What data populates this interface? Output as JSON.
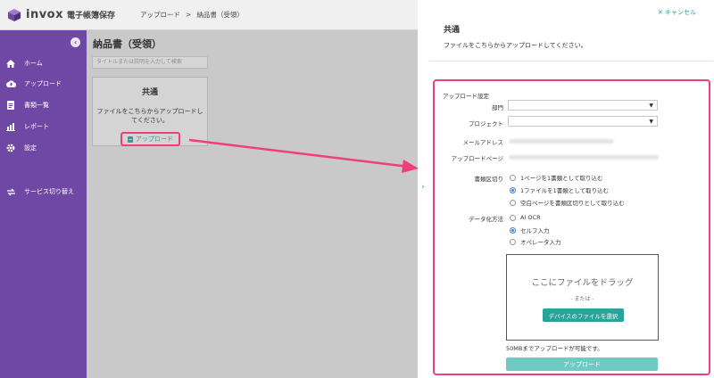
{
  "header": {
    "logo_text": "invox",
    "logo_sub": "電子帳簿保存",
    "breadcrumb": [
      "アップロード",
      "納品書（受領）"
    ],
    "breadcrumb_sep": ">"
  },
  "sidebar": {
    "collapse_icon": "chevron-left-icon",
    "items": [
      {
        "label": "ホーム",
        "icon": "home-icon"
      },
      {
        "label": "アップロード",
        "icon": "cloud-upload-icon"
      },
      {
        "label": "書類一覧",
        "icon": "document-icon"
      },
      {
        "label": "レポート",
        "icon": "chart-icon"
      },
      {
        "label": "設定",
        "icon": "gear-icon"
      },
      {
        "label": "サービス切り替え",
        "icon": "switch-icon"
      }
    ]
  },
  "main": {
    "title": "納品書（受領）",
    "search_placeholder": "タイトルまたは説明を入力して検索",
    "card": {
      "title": "共通",
      "description": "ファイルをこちらからアップロードしてください。",
      "upload_label": "アップロード"
    }
  },
  "panel": {
    "cancel_label": "キャンセル",
    "title": "共通",
    "description": "ファイルをこちらからアップロードしてください。",
    "section_label": "アップロード設定",
    "department_label": "部門",
    "department_value": "",
    "project_label": "プロジェクト",
    "project_value": "",
    "email_label": "メールアドレス",
    "upload_page_label": "アップロードページ",
    "split_label": "書類区切り",
    "split_options": [
      {
        "label": "1ページを1書類として取り込む",
        "selected": false
      },
      {
        "label": "1ファイルを1書類として取り込む",
        "selected": true
      },
      {
        "label": "空白ページを書類区切りとして取り込む",
        "selected": false
      }
    ],
    "method_label": "データ化方法",
    "method_options": [
      {
        "label": "AI OCR",
        "selected": false
      },
      {
        "label": "セルフ入力",
        "selected": true
      },
      {
        "label": "オペレータ入力",
        "selected": false
      }
    ],
    "dropzone_title": "ここにファイルをドラッグ",
    "dropzone_or": "- または -",
    "select_file_label": "デバイスのファイルを選択",
    "limit_note": "50MBまでアップロードが可能です。",
    "submit_label": "アップロード"
  },
  "colors": {
    "sidebar": "#6f48a5",
    "accent": "#2aa39a",
    "highlight": "#ee3f7c"
  }
}
